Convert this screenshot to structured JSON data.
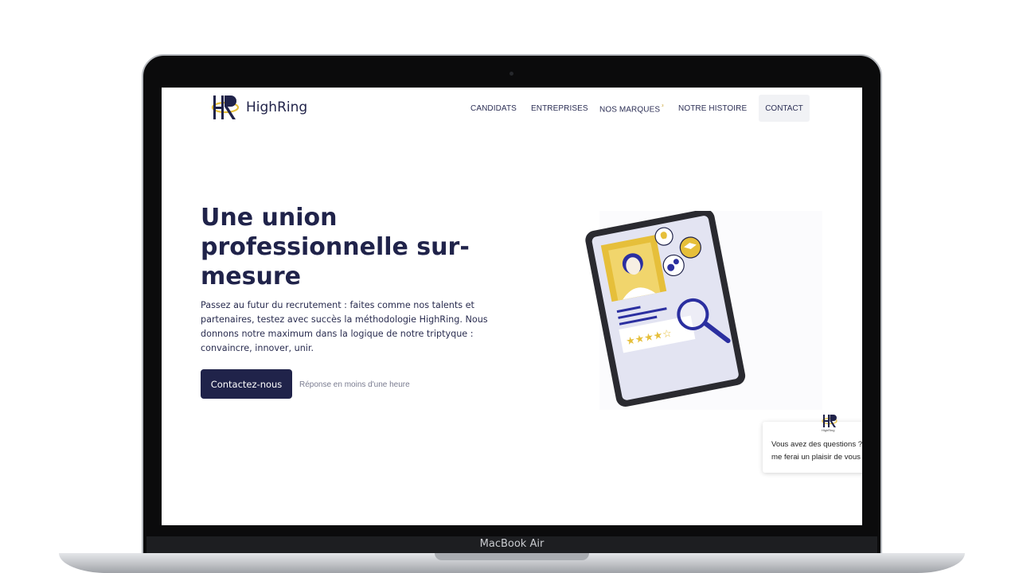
{
  "device": {
    "model_label": "MacBook Air"
  },
  "site": {
    "brand": "HighRing",
    "logo_letters": "HR",
    "nav": [
      {
        "label": "CANDIDATS"
      },
      {
        "label": "ENTREPRISES"
      },
      {
        "label": "NOS MARQUES",
        "indicator": "³"
      },
      {
        "label": "NOTRE HISTOIRE"
      },
      {
        "label": "CONTACT"
      }
    ]
  },
  "hero": {
    "title": "Une union professionnelle sur-mesure",
    "text": "Passez au futur du recrutement : faites comme nos talents et partenaires, testez avec succès la méthodologie HighRing. Nous donnons notre maximum dans la logique de notre triptyque : convaincre, innover, unir.",
    "cta_label": "Contactez-nous",
    "cta_note": "Réponse en moins d'une heure"
  },
  "chat": {
    "brand": "HighRing",
    "message_line1": "Vous avez des questions ?",
    "message_line2": "me ferai un plaisir de vous"
  },
  "colors": {
    "navy": "#20234a",
    "gold": "#e6bf3a",
    "accent_blue": "#2b2fa0"
  }
}
